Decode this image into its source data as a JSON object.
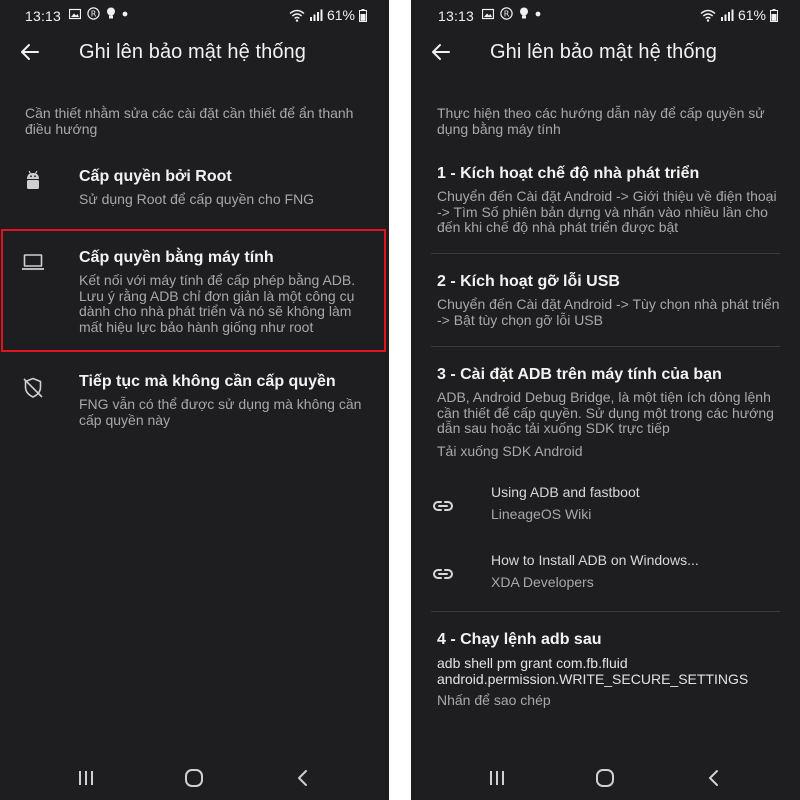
{
  "status": {
    "time": "13:13",
    "battery": "61%"
  },
  "left": {
    "title": "Ghi lên bảo mật hệ thống",
    "intro": [
      "Cần thiết nhằm sửa các cài đặt cần thiết để ẩn thanh",
      "điều hướng"
    ],
    "options": [
      {
        "icon": "android-icon",
        "title": "Cấp quyền bởi Root",
        "desc": [
          "Sử dụng Root để cấp quyền cho FNG"
        ]
      },
      {
        "icon": "laptop-icon",
        "title": "Cấp quyền bằng máy tính",
        "desc": [
          "Kết nối với máy tính để cấp phép bằng ADB.",
          "Lưu ý rằng ADB chỉ đơn giản là một công cụ",
          "dành cho nhà phát triển và nó sẽ không làm",
          "mất hiệu lực bảo hành giống như root"
        ]
      },
      {
        "icon": "shield-off-icon",
        "title": "Tiếp tục mà không cần cấp quyền",
        "desc": [
          "FNG vẫn có thể được sử dụng mà không cần",
          "cấp quyền này"
        ]
      }
    ]
  },
  "right": {
    "title": "Ghi lên bảo mật hệ thống",
    "intro": [
      "Thực hiện theo các hướng dẫn này để cấp quyền sử",
      "dụng bằng máy tính"
    ],
    "step1": {
      "title": "1 - Kích hoạt chế độ nhà phát triển",
      "desc": [
        "Chuyển đến Cài đặt Android -> Giới thiệu về điện thoại",
        "-> Tìm Số phiên bản dựng và nhấn vào nhiều lần cho",
        "đến khi chế độ nhà phát triển được bật"
      ]
    },
    "step2": {
      "title": "2 - Kích hoạt gỡ lỗi USB",
      "desc": [
        "Chuyển đến Cài đặt Android -> Tùy chọn nhà phát triển",
        "-> Bật tùy chọn gỡ lỗi USB"
      ]
    },
    "step3": {
      "title": "3 - Cài đặt ADB trên máy tính của bạn",
      "desc": [
        "ADB, Android Debug Bridge, là một tiện ích dòng lệnh",
        "cần thiết để cấp quyền. Sử dụng một trong các hướng",
        "dẫn sau hoặc tải xuống SDK trực tiếp"
      ],
      "download": "Tải xuống SDK Android",
      "links": [
        {
          "title": "Using ADB and fastboot",
          "sub": "LineageOS Wiki"
        },
        {
          "title": "How to Install ADB on Windows...",
          "sub": "XDA Developers"
        }
      ]
    },
    "step4": {
      "title": "4 - Chạy lệnh adb sau",
      "cmd": [
        "adb shell pm grant com.fb.fluid",
        "android.permission.WRITE_SECURE_SETTINGS"
      ],
      "copy": "Nhấn để sao chép"
    }
  }
}
